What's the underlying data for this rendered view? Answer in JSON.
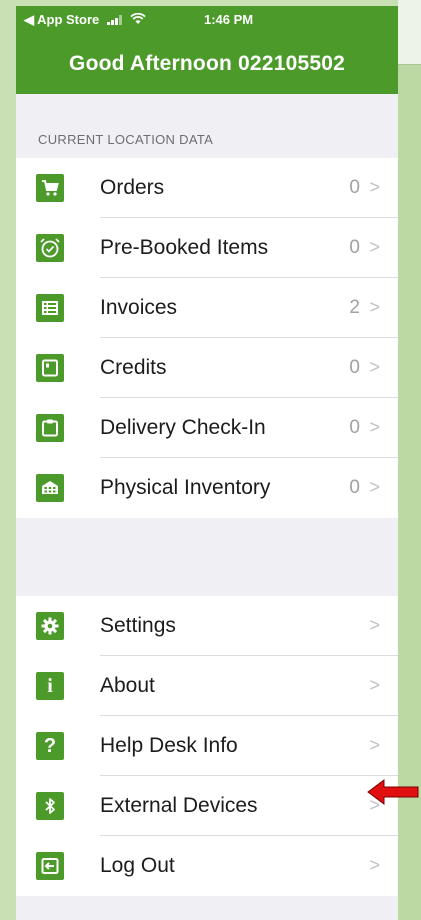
{
  "status": {
    "back_label": "◀ App Store",
    "time": "1:46 PM"
  },
  "header": {
    "greeting": "Good Afternoon 022105502"
  },
  "location_section": {
    "title": "CURRENT LOCATION DATA",
    "items": [
      {
        "label": "Orders",
        "count": "0",
        "icon": "cart-icon"
      },
      {
        "label": "Pre-Booked Items",
        "count": "0",
        "icon": "alarm-clock-icon"
      },
      {
        "label": "Invoices",
        "count": "2",
        "icon": "list-icon"
      },
      {
        "label": "Credits",
        "count": "0",
        "icon": "note-icon"
      },
      {
        "label": "Delivery Check-In",
        "count": "0",
        "icon": "clipboard-icon"
      },
      {
        "label": "Physical Inventory",
        "count": "0",
        "icon": "inventory-grid-icon"
      }
    ]
  },
  "settings_section": {
    "items": [
      {
        "label": "Settings",
        "icon": "gear-icon"
      },
      {
        "label": "About",
        "icon": "info-icon"
      },
      {
        "label": "Help Desk Info",
        "icon": "question-icon"
      },
      {
        "label": "External Devices",
        "icon": "bluetooth-icon"
      },
      {
        "label": "Log Out",
        "icon": "logout-icon"
      }
    ]
  },
  "colors": {
    "accent": "#4c9a2a",
    "annotation_arrow": "#e01010"
  }
}
